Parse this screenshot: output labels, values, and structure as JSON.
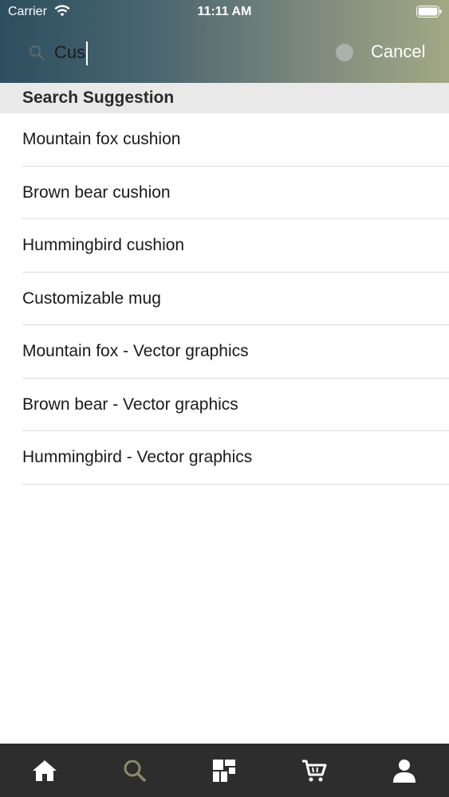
{
  "status_bar": {
    "carrier": "Carrier",
    "time": "11:11 AM"
  },
  "search": {
    "value": "Cus",
    "cancel_label": "Cancel"
  },
  "section": {
    "title": "Search Suggestion"
  },
  "suggestions": [
    "Mountain fox cushion",
    "Brown bear cushion",
    "Hummingbird cushion",
    "Customizable mug",
    "Mountain fox - Vector graphics",
    "Brown bear - Vector graphics",
    "Hummingbird - Vector graphics"
  ],
  "tab_bar": {
    "tabs": [
      {
        "icon": "home-icon",
        "active": false
      },
      {
        "icon": "search-icon",
        "active": true
      },
      {
        "icon": "categories-icon",
        "active": false
      },
      {
        "icon": "cart-icon",
        "active": false
      },
      {
        "icon": "account-icon",
        "active": false
      }
    ],
    "active_color": "#8a8a6a",
    "inactive_color": "#ffffff"
  },
  "colors": {
    "header_gradient_start": "#2c4f5f",
    "header_gradient_end": "#a3a884",
    "section_bg": "#e9e9ea",
    "tab_bar_bg": "#2d2d2d"
  }
}
